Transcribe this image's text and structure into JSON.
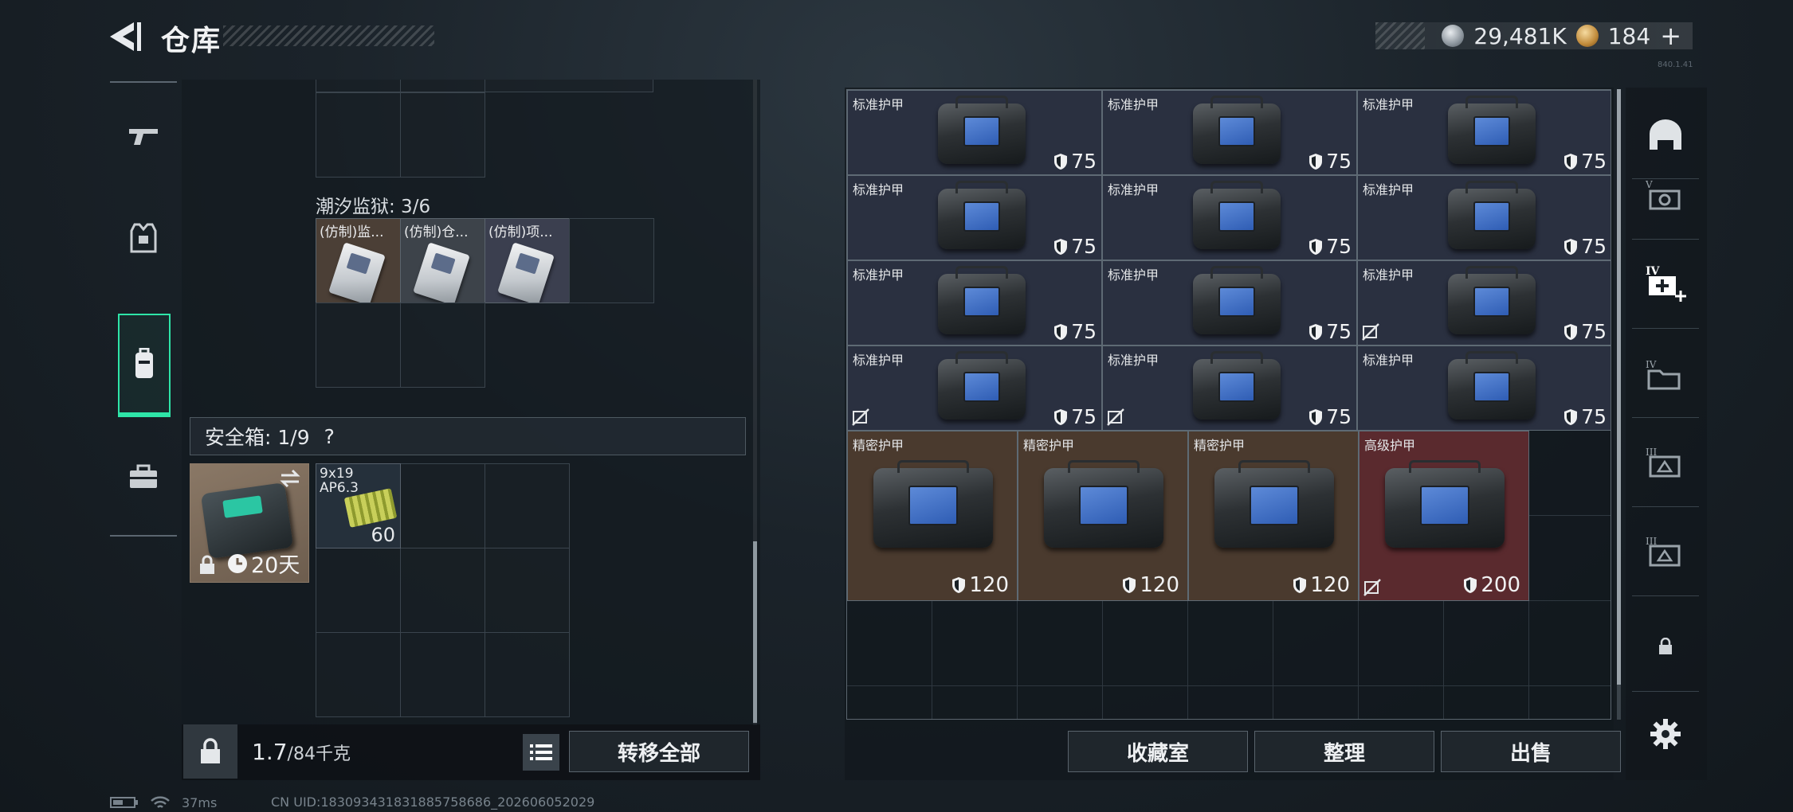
{
  "header": {
    "title": "仓库",
    "currency_silver": "29,481K",
    "currency_gold": "184",
    "gold_add": "+",
    "version_tag": "840.1.41"
  },
  "left_panel": {
    "prison_label": "潮汐监狱: 3/6",
    "prison_items": [
      "(仿制)监...",
      "(仿制)仓...",
      "(仿制)项..."
    ],
    "safe_box_label": "安全箱: 1/9",
    "safe_box_help": "?",
    "safe_box_duration": "20天",
    "ammo": {
      "caliber": "9x19",
      "type": "AP6.3",
      "count": "60"
    },
    "weight_current": "1.7",
    "weight_max": "/84千克",
    "transfer_all_label": "转移全部"
  },
  "armor_items": [
    {
      "label": "标准护甲",
      "value": "75",
      "rarity": "std",
      "flag": false
    },
    {
      "label": "标准护甲",
      "value": "75",
      "rarity": "std",
      "flag": false
    },
    {
      "label": "标准护甲",
      "value": "75",
      "rarity": "std",
      "flag": false
    },
    {
      "label": "标准护甲",
      "value": "75",
      "rarity": "std",
      "flag": false
    },
    {
      "label": "标准护甲",
      "value": "75",
      "rarity": "std",
      "flag": false
    },
    {
      "label": "标准护甲",
      "value": "75",
      "rarity": "std",
      "flag": false
    },
    {
      "label": "标准护甲",
      "value": "75",
      "rarity": "std",
      "flag": false
    },
    {
      "label": "标准护甲",
      "value": "75",
      "rarity": "std",
      "flag": false
    },
    {
      "label": "标准护甲",
      "value": "75",
      "rarity": "std",
      "flag": true
    },
    {
      "label": "标准护甲",
      "value": "75",
      "rarity": "std",
      "flag": true
    },
    {
      "label": "标准护甲",
      "value": "75",
      "rarity": "std",
      "flag": true
    },
    {
      "label": "标准护甲",
      "value": "75",
      "rarity": "std",
      "flag": false
    }
  ],
  "armor_big": [
    {
      "label": "精密护甲",
      "value": "120",
      "rarity": "prec",
      "flag": false
    },
    {
      "label": "精密护甲",
      "value": "120",
      "rarity": "prec",
      "flag": false
    },
    {
      "label": "精密护甲",
      "value": "120",
      "rarity": "prec",
      "flag": false
    },
    {
      "label": "高级护甲",
      "value": "200",
      "rarity": "high",
      "flag": true
    }
  ],
  "actions": {
    "collection_room": "收藏室",
    "organize": "整理",
    "sell": "出售"
  },
  "rail": [
    "helmet-filter",
    "IV",
    "IV+",
    "IV",
    "III",
    "III"
  ],
  "status": {
    "ping": "37ms",
    "uid": "CN UID:18309343183188575868­6_202606052029"
  },
  "colors": {
    "accent": "#2ee5a8",
    "std": "#2a3040",
    "prec": "#4a3a2e",
    "high": "#5a2a2e"
  }
}
